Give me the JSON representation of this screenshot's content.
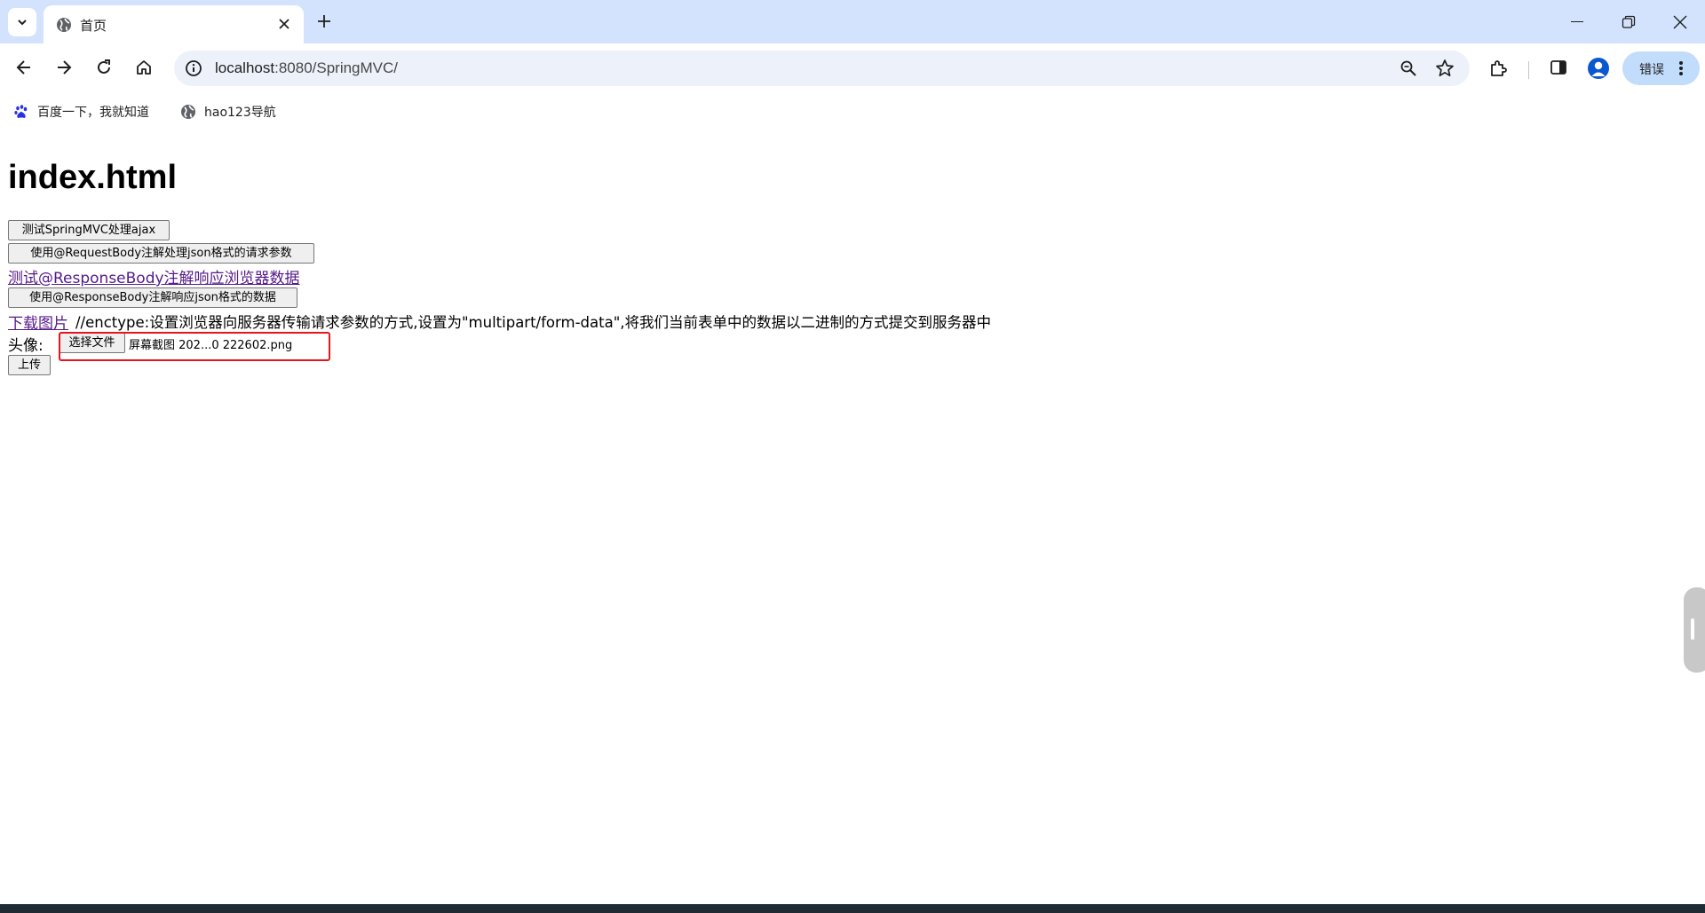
{
  "browser": {
    "tab_title": "首页",
    "url_host": "localhost",
    "url_rest": ":8080/SpringMVC/",
    "profile_chip_label": "错误"
  },
  "bookmarks": [
    {
      "label": "百度一下，我就知道",
      "icon": "baidu-paw-icon"
    },
    {
      "label": "hao123导航",
      "icon": "globe-icon"
    }
  ],
  "page": {
    "heading": "index.html",
    "ajax_button": "测试SpringMVC处理ajax",
    "request_body_button": "使用@RequestBody注解处理json格式的请求参数",
    "response_body_link": "测试@ResponseBody注解响应浏览器数据",
    "response_json_button": "使用@ResponseBody注解响应json格式的数据",
    "download_link": "下载图片",
    "enctype_note": "//enctype:设置浏览器向服务器传输请求参数的方式,设置为\"multipart/form-data\",将我们当前表单中的数据以二进制的方式提交到服务器中",
    "avatar_label": "头像:",
    "choose_file_button": "选择文件",
    "chosen_file_name": "屏幕截图 202...0 222602.png",
    "upload_button": "上传"
  },
  "colors": {
    "tabstrip_bg": "#d3e3fd",
    "omnibox_bg": "#edf2fa",
    "link_visited": "#551a8b",
    "highlight_box": "#e8141b"
  }
}
